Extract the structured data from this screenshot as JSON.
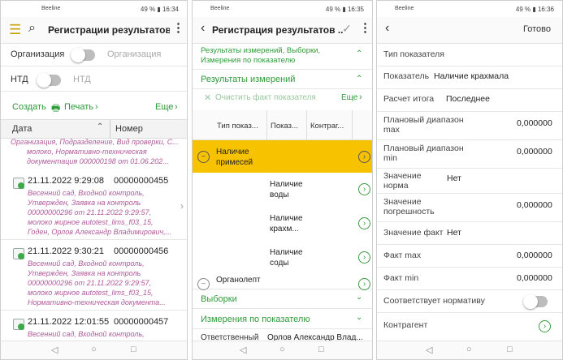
{
  "status": {
    "p1_carrier": "Beeline",
    "p1_right": "49 % ▮ 16:34",
    "p2_carrier": "Beeline",
    "p2_right": "49 % ▮ 16:35",
    "p3_carrier": "Beeline",
    "p3_right": "49 % ▮ 16:36"
  },
  "screen1": {
    "title": "Регистрации результатов ...",
    "org_label": "Организация",
    "org_value": "Организация",
    "ntd_label": "НТД",
    "ntd_value": "НТД",
    "create_label": "Создать",
    "print_label": "Печать",
    "more_label": "Еще",
    "col_date": "Дата",
    "col_number": "Номер",
    "header_sub": "Организация, Подразделение, Вид проверки, С...",
    "partial_lines": [
      "молоко, Нормативно-техническая",
      "документация 000000198 от 01.06.202..."
    ],
    "records": [
      {
        "date": "21.11.2022 9:29:08",
        "number": "00000000455",
        "lines": [
          "Весенний сад, Входной контроль,",
          "Утвержден, Заявка на контроль",
          "00000000296 от 21.11.2022 9:29:57,",
          "молоко жирное autotest_lims_f03_15,",
          "Годен, Орлов Александр Владимирович,..."
        ]
      },
      {
        "date": "21.11.2022 9:30:21",
        "number": "00000000456",
        "lines": [
          "Весенний сад, Входной контроль,",
          "Утвержден, Заявка на контроль",
          "00000000296 от 21.11.2022 9:29:57,",
          "молоко жирное autotest_lims_f03_15,",
          "Нормативно-техническая документа..."
        ]
      },
      {
        "date": "21.11.2022 12:01:55",
        "number": "00000000457",
        "lines": [
          "Весенний сад, Входной контроль,"
        ]
      }
    ]
  },
  "screen2": {
    "title": "Регистрация результатов ...",
    "sec_top": "Результаты измерений, Выборки, Измерения по показателю",
    "sec_results": "Результаты измерений",
    "clear_label": "Очистить факт показателя",
    "more_label": "Еще",
    "col_type": "Тип показ...",
    "col_ind": "Показ...",
    "col_contr": "Контраг...",
    "group1": "Наличие примесей",
    "items": [
      "Наличие воды",
      "Наличие крахм...",
      "Наличие соды"
    ],
    "group2": "Органолепт",
    "sec_samples": "Выборки",
    "sec_measures": "Измерения по показателю",
    "resp_label": "Ответственный",
    "resp_value": "Орлов Александр Влад..."
  },
  "screen3": {
    "done": "Готово",
    "fields": [
      {
        "label": "Тип показателя",
        "value": ""
      },
      {
        "label": "Показатель",
        "value": "Наличие крахмала"
      },
      {
        "label": "Расчет итога",
        "value": "Последнее"
      },
      {
        "label": "Плановый диапазон max",
        "value": "0,000000"
      },
      {
        "label": "Плановый диапазон min",
        "value": "0,000000"
      },
      {
        "label": "Значение норма",
        "value": "Нет"
      },
      {
        "label": "Значение погрешность",
        "value": "0,000000"
      },
      {
        "label": "Значение факт",
        "value": "Нет"
      },
      {
        "label": "Факт max",
        "value": "0,000000"
      },
      {
        "label": "Факт min",
        "value": "0,000000"
      },
      {
        "label": "Соответствует нормативу",
        "value": ""
      },
      {
        "label": "Контрагент",
        "value": ""
      }
    ]
  },
  "nav": {
    "back": "◁",
    "home": "○",
    "recent": "□"
  },
  "colors": {
    "accent_green": "#2e9b3a",
    "selected_row": "#f7c200",
    "subtext": "#b1599c"
  }
}
